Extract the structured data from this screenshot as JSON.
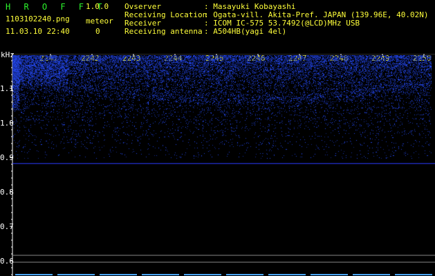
{
  "header": {
    "app_name": "H R O F F T",
    "version": "1.0.0",
    "filename": "1103102240.png",
    "datetime": "11.03.10 22:40",
    "meteor_label": "meteor",
    "meteor_count": "0",
    "fields": [
      {
        "label": "Ovserver",
        "value": ": Masayuki Kobayashi"
      },
      {
        "label": "Receiving Location",
        "value": ": Ogata-vill. Akita-Pref. JAPAN (139.96E, 40.02N)"
      },
      {
        "label": "Receiver",
        "value": ": ICOM IC-575 53.7492(@LCD)MHz USB"
      },
      {
        "label": "Receiving antenna",
        "value": ": A504HB(yagi 4el)"
      }
    ]
  },
  "spectrogram": {
    "y_unit": "kHz",
    "y_ticks": [
      "1.1",
      "1.0",
      "0.9",
      "0.8",
      "0.7",
      "0.6"
    ],
    "x_ticks": [
      "2241",
      "2242",
      "2243",
      "2244",
      "2245",
      "2246",
      "2247",
      "2248",
      "2249",
      "2250"
    ]
  },
  "colors": {
    "signal": "#2040ff",
    "axis": "#ffffff",
    "ref_line": "#2a3aff"
  }
}
